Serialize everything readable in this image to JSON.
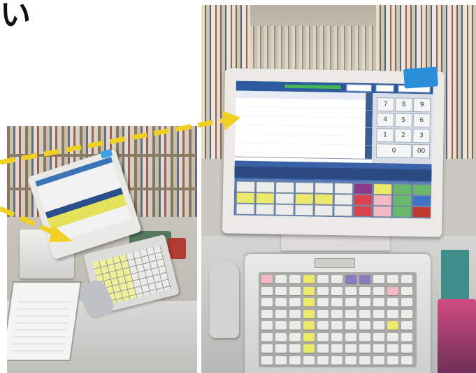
{
  "headline": {
    "text": "い"
  },
  "colors": {
    "arrow": "#f0d024",
    "screen_blue": "#2d5a9e",
    "key_yellow": "#ecea6c",
    "key_gray": "#ececea",
    "key_pink": "#f2b8c4",
    "key_green": "#6ab86c"
  },
  "numpad": {
    "keys": [
      "7",
      "8",
      "9",
      "4",
      "5",
      "6",
      "1",
      "2",
      "3",
      "0",
      "00"
    ]
  },
  "icons": {
    "arrow_to_screen": "dashed-arrow-icon",
    "arrow_to_monitor": "dashed-arrow-icon"
  }
}
